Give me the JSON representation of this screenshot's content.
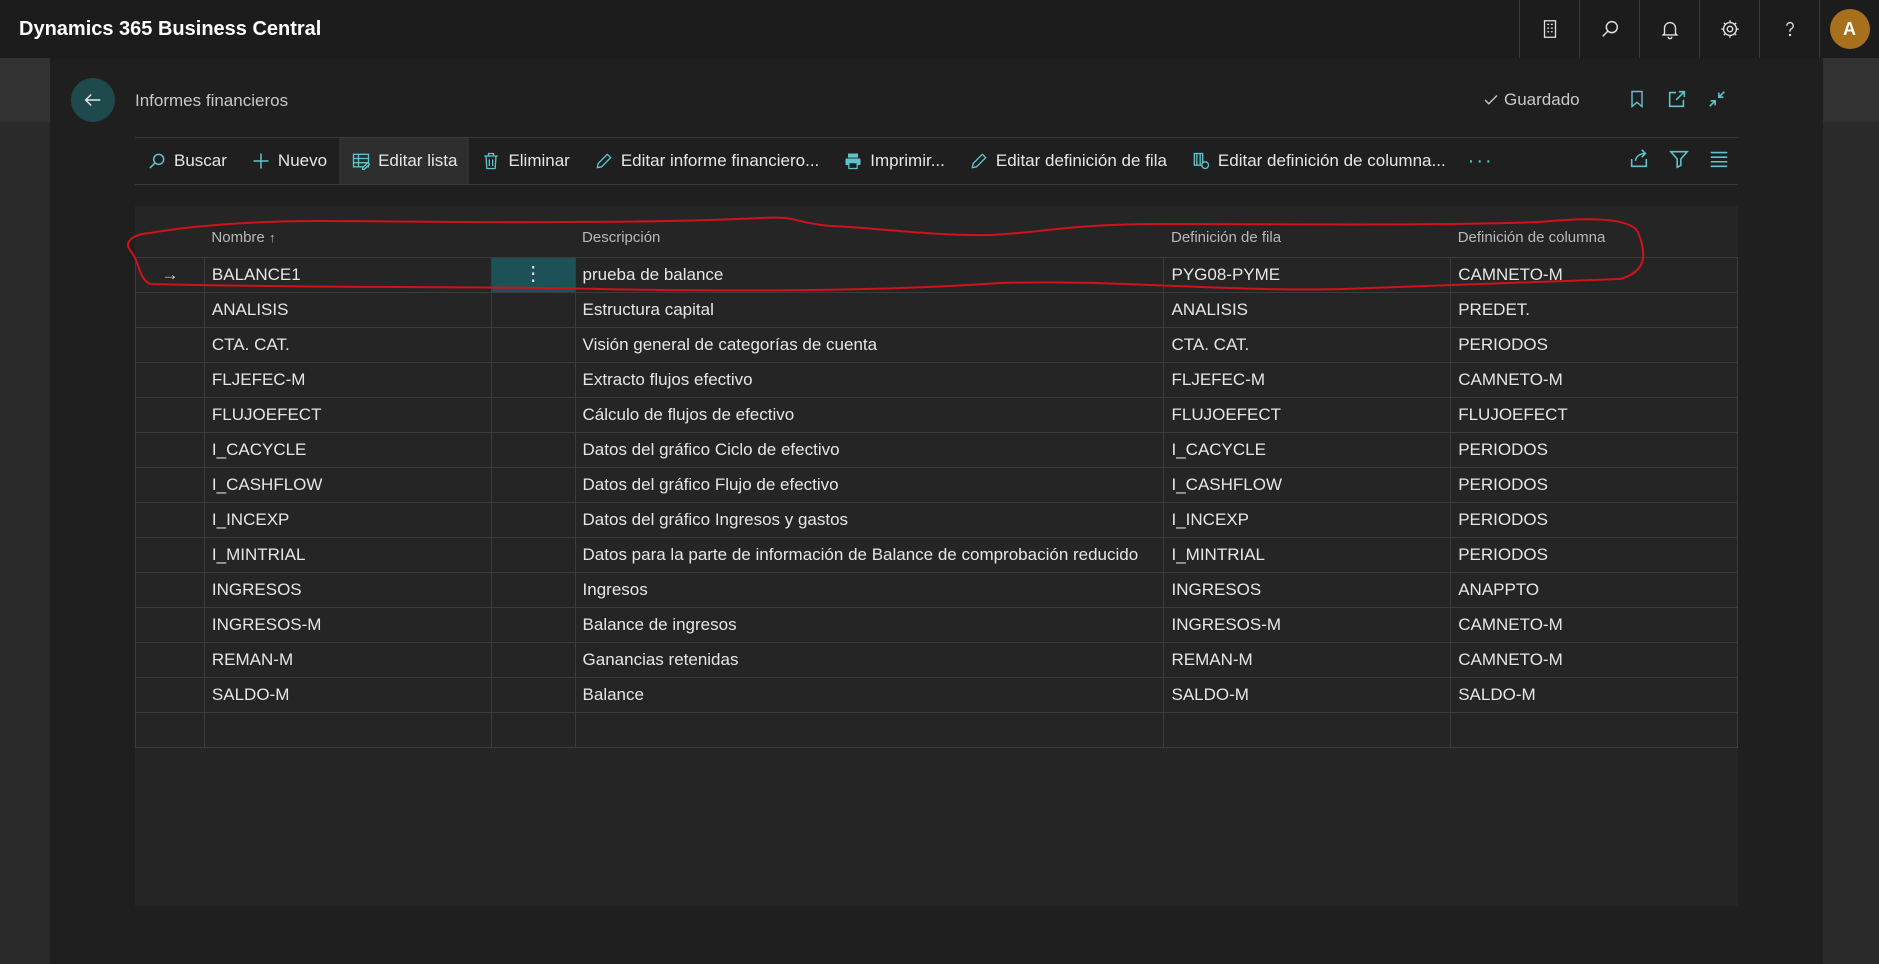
{
  "app": {
    "title": "Dynamics 365 Business Central",
    "avatar_initial": "A"
  },
  "topbar_icons": [
    "building-icon",
    "search-icon",
    "bell-icon",
    "gear-icon",
    "help-icon"
  ],
  "page": {
    "title": "Informes financieros",
    "saved_label": "Guardado"
  },
  "actions": {
    "buscar": "Buscar",
    "nuevo": "Nuevo",
    "editar_lista": "Editar lista",
    "eliminar": "Eliminar",
    "editar_informe": "Editar informe financiero...",
    "imprimir": "Imprimir...",
    "editar_fila": "Editar definición de fila",
    "editar_columna": "Editar definición de columna...",
    "more": "···"
  },
  "table": {
    "headers": {
      "nombre": "Nombre",
      "descripcion": "Descripción",
      "def_fila": "Definición de fila",
      "def_columna": "Definición de columna"
    },
    "selected_row": 0,
    "rows": [
      {
        "nombre": "BALANCE1",
        "descripcion": "prueba de balance",
        "fila": "PYG08-PYME",
        "columna": "CAMNETO-M"
      },
      {
        "nombre": "ANALISIS",
        "descripcion": "Estructura capital",
        "fila": "ANALISIS",
        "columna": "PREDET."
      },
      {
        "nombre": "CTA. CAT.",
        "descripcion": "Visión general de categorías de cuenta",
        "fila": "CTA. CAT.",
        "columna": "PERIODOS"
      },
      {
        "nombre": "FLJEFEC-M",
        "descripcion": "Extracto flujos efectivo",
        "fila": "FLJEFEC-M",
        "columna": "CAMNETO-M"
      },
      {
        "nombre": "FLUJOEFECT",
        "descripcion": "Cálculo de flujos de efectivo",
        "fila": "FLUJOEFECT",
        "columna": "FLUJOEFECT"
      },
      {
        "nombre": "I_CACYCLE",
        "descripcion": "Datos del gráfico Ciclo de efectivo",
        "fila": "I_CACYCLE",
        "columna": "PERIODOS"
      },
      {
        "nombre": "I_CASHFLOW",
        "descripcion": "Datos del gráfico Flujo de efectivo",
        "fila": "I_CASHFLOW",
        "columna": "PERIODOS"
      },
      {
        "nombre": "I_INCEXP",
        "descripcion": "Datos del gráfico Ingresos y gastos",
        "fila": "I_INCEXP",
        "columna": "PERIODOS"
      },
      {
        "nombre": "I_MINTRIAL",
        "descripcion": "Datos para la parte de información de Balance de comprobación reducido",
        "fila": "I_MINTRIAL",
        "columna": "PERIODOS"
      },
      {
        "nombre": "INGRESOS",
        "descripcion": "Ingresos",
        "fila": "INGRESOS",
        "columna": "ANAPPTO"
      },
      {
        "nombre": "INGRESOS-M",
        "descripcion": "Balance de ingresos",
        "fila": "INGRESOS-M",
        "columna": "CAMNETO-M"
      },
      {
        "nombre": "REMAN-M",
        "descripcion": "Ganancias retenidas",
        "fila": "REMAN-M",
        "columna": "CAMNETO-M"
      },
      {
        "nombre": "SALDO-M",
        "descripcion": "Balance",
        "fila": "SALDO-M",
        "columna": "SALDO-M"
      }
    ]
  },
  "colors": {
    "accent": "#5fc4c9",
    "selected_cell": "#1d5158",
    "annotation": "#d0121b",
    "avatar": "#a8701c"
  }
}
